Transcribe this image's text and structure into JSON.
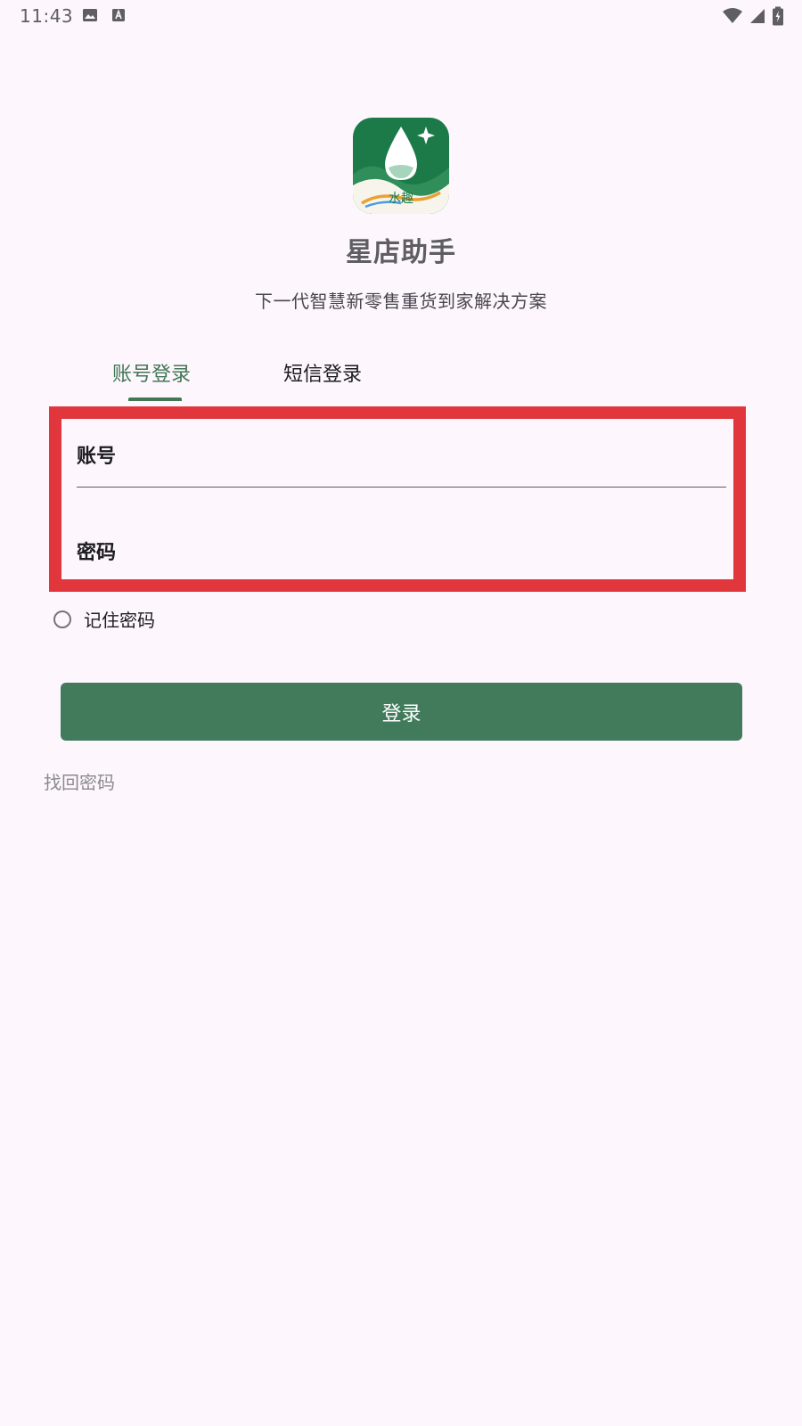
{
  "status_bar": {
    "time": "11:43",
    "left_icons": [
      "image-icon",
      "text-a-icon"
    ],
    "right_icons": [
      "wifi-icon",
      "signal-icon",
      "battery-charging-icon"
    ]
  },
  "app": {
    "logo_icon": "water-drop-app-logo",
    "logo_text": "水趣",
    "title": "星店助手",
    "subtitle": "下一代智慧新零售重货到家解决方案"
  },
  "tabs": [
    {
      "label": "账号登录",
      "active": true
    },
    {
      "label": "短信登录",
      "active": false
    }
  ],
  "form": {
    "account_label": "账号",
    "password_label": "密码",
    "remember_label": "记住密码",
    "remember_checked": false,
    "login_button": "登录",
    "recover_link": "找回密码"
  },
  "colors": {
    "background": "#fdf7fd",
    "accent": "#427656",
    "button": "#427b5b",
    "highlight": "#e0363c"
  }
}
